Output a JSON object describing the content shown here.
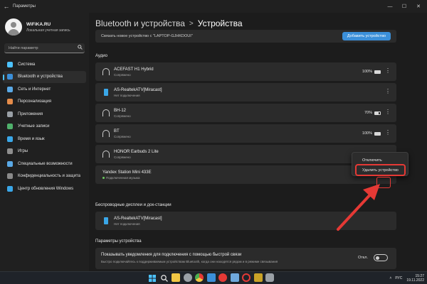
{
  "window": {
    "title": "Параметры",
    "back_glyph": "←",
    "minimize_glyph": "—",
    "maximize_glyph": "☐",
    "close_glyph": "✕"
  },
  "profile": {
    "name": "WiFiKA.RU",
    "account_type": "Локальная учетная запись"
  },
  "search": {
    "placeholder": "Найти параметр",
    "icon": "search-icon"
  },
  "sidebar": {
    "items": [
      {
        "label": "Система",
        "icon": "system-icon",
        "color": "#4cc2ff",
        "active": false
      },
      {
        "label": "Bluetooth и устройства",
        "icon": "bluetooth-icon",
        "color": "#3b8fd9",
        "active": true
      },
      {
        "label": "Сеть и Интернет",
        "icon": "network-icon",
        "color": "#5aa9e6",
        "active": false
      },
      {
        "label": "Персонализация",
        "icon": "brush-icon",
        "color": "#e58c4a",
        "active": false
      },
      {
        "label": "Приложения",
        "icon": "apps-icon",
        "color": "#9aa0a6",
        "active": false
      },
      {
        "label": "Учетные записи",
        "icon": "accounts-icon",
        "color": "#4fb06b",
        "active": false
      },
      {
        "label": "Время и язык",
        "icon": "time-language-icon",
        "color": "#3aa7e8",
        "active": false
      },
      {
        "label": "Игры",
        "icon": "gaming-icon",
        "color": "#8e8e8e",
        "active": false
      },
      {
        "label": "Специальные возможности",
        "icon": "accessibility-icon",
        "color": "#5aa9e6",
        "active": false
      },
      {
        "label": "Конфиденциальность и защита",
        "icon": "shield-icon",
        "color": "#8a8a8a",
        "active": false
      },
      {
        "label": "Центр обновления Windows",
        "icon": "windows-update-icon",
        "color": "#3aa7e8",
        "active": false
      }
    ]
  },
  "breadcrumb": {
    "parent": "Bluetooth и устройства",
    "separator": ">",
    "current": "Устройства"
  },
  "pairing": {
    "text": "Связать новое устройство с \"LAPTOP-GJHKDOUI\"",
    "button": "Добавить устройство"
  },
  "audio": {
    "title": "Аудио",
    "devices": [
      {
        "name": "ACEFAST H1 Hybrid",
        "status": "Сопряжено",
        "battery": "100%",
        "battery_level": 1.0,
        "icon": "headphones-icon"
      },
      {
        "name": "AS-RealtekATV[Miracast]",
        "status": "Нет подключения",
        "battery": "",
        "battery_level": null,
        "icon": "tv-device-icon"
      },
      {
        "name": "BH-12",
        "status": "Сопряжено",
        "battery": "70%",
        "battery_level": 0.7,
        "icon": "headphones-icon"
      },
      {
        "name": "BT",
        "status": "Сопряжено",
        "battery": "100%",
        "battery_level": 1.0,
        "icon": "headphones-icon"
      },
      {
        "name": "HONOR Earbuds 2 Lite",
        "status": "Сопряжено",
        "battery": "",
        "battery_level": null,
        "icon": "headphones-icon"
      },
      {
        "name": "Yandex Station Mini 433E",
        "status": "Подключенная музыка",
        "battery": "",
        "battery_level": null,
        "icon": "speaker-icon"
      }
    ]
  },
  "context_menu": {
    "items": [
      "Отключить",
      "Удалить устройство"
    ],
    "highlight_color": "#e53935"
  },
  "wireless": {
    "title": "Беспроводные дисплеи и док-станции",
    "devices": [
      {
        "name": "AS-RealtekATV[Miracast]",
        "status": "Нет подключения",
        "icon": "tv-device-icon"
      }
    ]
  },
  "device_settings": {
    "title": "Параметры устройства",
    "toggle_title": "Показывать уведомления для подключения с помощью быстрой связи",
    "toggle_desc": "Быстро подключайтесь к поддерживаемым устройствам Bluetooth, когда они находятся рядом и в режиме связывания",
    "toggle_state": "Откл."
  },
  "more_glyph": "⋮",
  "taskbar": {
    "apps": [
      {
        "icon": "windows-start-icon",
        "color": "#4cc2ff"
      },
      {
        "icon": "search-icon",
        "color": "#dddddd"
      },
      {
        "icon": "file-explorer-icon",
        "color": "#f2c744"
      },
      {
        "icon": "settings-icon",
        "color": "#9aa0a6"
      },
      {
        "icon": "chrome-icon",
        "color": "#4caf50"
      },
      {
        "icon": "store-icon",
        "color": "#3b8fd9"
      },
      {
        "icon": "yandex-icon",
        "color": "#e53935"
      },
      {
        "icon": "photos-icon",
        "color": "#6fa8dc"
      },
      {
        "icon": "opera-icon",
        "color": "#e53935"
      },
      {
        "icon": "media-icon",
        "color": "#c9a227"
      },
      {
        "icon": "settings-gear-icon",
        "color": "#9aa0a6"
      }
    ],
    "tray": {
      "language": "РУС",
      "time": "15:27",
      "date": "19.11.2022"
    }
  }
}
